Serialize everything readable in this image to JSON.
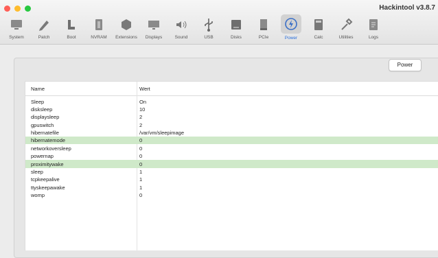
{
  "window": {
    "title": "Hackintool v3.8.7"
  },
  "toolbar": {
    "items": [
      {
        "label": "System",
        "icon": "monitor-icon"
      },
      {
        "label": "Patch",
        "icon": "pencil-icon"
      },
      {
        "label": "Boot",
        "icon": "boot-icon"
      },
      {
        "label": "NVRAM",
        "icon": "nvram-chip-icon"
      },
      {
        "label": "Extensions",
        "icon": "extensions-cube-icon"
      },
      {
        "label": "Displays",
        "icon": "display-icon"
      },
      {
        "label": "Sound",
        "icon": "speaker-icon"
      },
      {
        "label": "USB",
        "icon": "usb-icon"
      },
      {
        "label": "Disks",
        "icon": "disk-icon"
      },
      {
        "label": "PCIe",
        "icon": "pcie-card-icon"
      },
      {
        "label": "Power",
        "icon": "power-icon",
        "active": true
      },
      {
        "label": "Calc",
        "icon": "calculator-icon"
      },
      {
        "label": "Utilities",
        "icon": "wrench-icon"
      },
      {
        "label": "Logs",
        "icon": "log-icon"
      }
    ]
  },
  "main": {
    "power_button": "Power",
    "table": {
      "headers": [
        "Name",
        "Wert"
      ],
      "rows": [
        {
          "name": "Sleep",
          "value": "On"
        },
        {
          "name": "disksleep",
          "value": "10"
        },
        {
          "name": "displaysleep",
          "value": "2"
        },
        {
          "name": "gpuswitch",
          "value": "2"
        },
        {
          "name": "hibernatefile",
          "value": "/var/vm/sleepimage"
        },
        {
          "name": "hibernatemode",
          "value": "0",
          "highlight": true
        },
        {
          "name": "networkoversleep",
          "value": "0"
        },
        {
          "name": "powernap",
          "value": "0"
        },
        {
          "name": "proximitywake",
          "value": "0",
          "highlight": true
        },
        {
          "name": "sleep",
          "value": "1"
        },
        {
          "name": "tcpkeepalive",
          "value": "1"
        },
        {
          "name": "ttyskeepawake",
          "value": "1"
        },
        {
          "name": "womp",
          "value": "0"
        }
      ]
    }
  },
  "colors": {
    "highlight": "#cfe9c9",
    "accent": "#2a6fdb"
  }
}
